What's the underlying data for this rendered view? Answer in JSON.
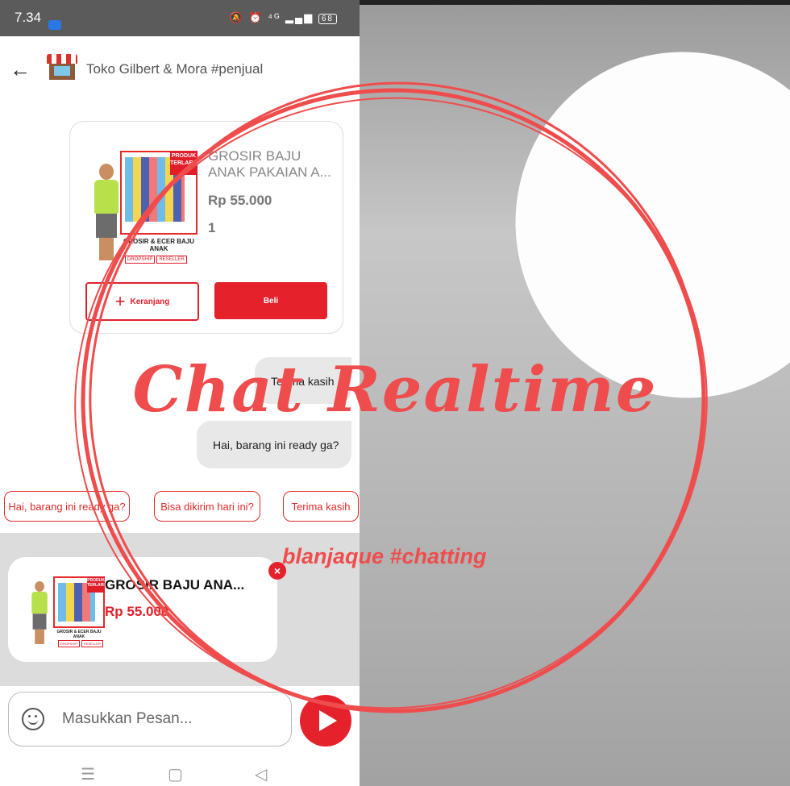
{
  "status_bar": {
    "time": "7.34",
    "network": "⁴ᴳ",
    "battery": "68"
  },
  "header": {
    "shop_name": "Toko Gilbert & Mora #penjual"
  },
  "product_card": {
    "title": "GROSIR BAJU ANAK PAKAIAN A...",
    "price": "Rp 55.000",
    "qty": "1",
    "cart_label": "Keranjang",
    "buy_label": "Beli",
    "poster_tag": "PRODUK TERLARIS",
    "poster_label": "GROSIR & ECER BAJU ANAK",
    "poster_chips": [
      "DROPSHIP",
      "RESELLER"
    ]
  },
  "messages": [
    {
      "text": "Terima kasih"
    },
    {
      "text": "Hai, barang ini ready ga?"
    }
  ],
  "quick_replies": [
    "Hai, barang ini ready ga?",
    "Bisa dikirim hari ini?",
    "Terima kasih"
  ],
  "preview": {
    "title": "GROSIR BAJU ANA...",
    "price": "Rp 55.000"
  },
  "input": {
    "placeholder": "Masukkan Pesan..."
  },
  "overlay": {
    "title": "Chat Realtime",
    "subtitle": "blanjaque #chatting"
  },
  "colors": {
    "accent": "#e5212c",
    "overlay": "#ef4d4d"
  }
}
